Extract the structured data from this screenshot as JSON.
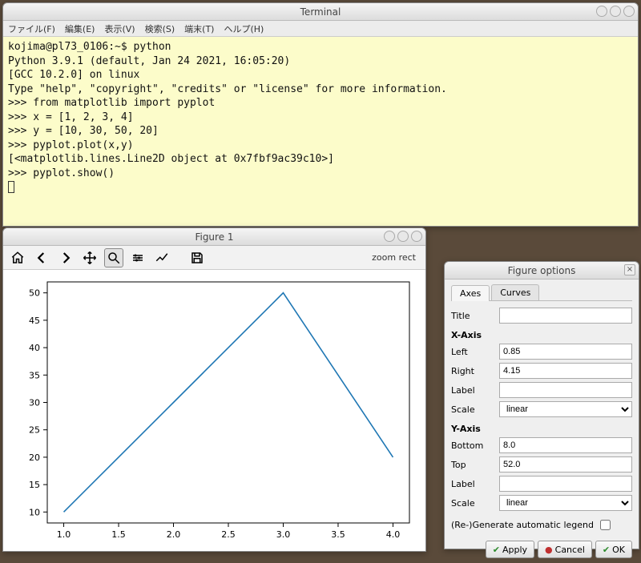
{
  "terminal": {
    "title": "Terminal",
    "menus": [
      "ファイル(F)",
      "編集(E)",
      "表示(V)",
      "検索(S)",
      "端末(T)",
      "ヘルプ(H)"
    ],
    "lines": [
      "kojima@pl73_0106:~$ python",
      "Python 3.9.1 (default, Jan 24 2021, 16:05:20)",
      "[GCC 10.2.0] on linux",
      "Type \"help\", \"copyright\", \"credits\" or \"license\" for more information.",
      ">>> from matplotlib import pyplot",
      ">>> x = [1, 2, 3, 4]",
      ">>> y = [10, 30, 50, 20]",
      ">>> pyplot.plot(x,y)",
      "[<matplotlib.lines.Line2D object at 0x7fbf9ac39c10>]",
      ">>> pyplot.show()"
    ]
  },
  "figure": {
    "title": "Figure 1",
    "toolbar_hint": "zoom rect",
    "toolbar_buttons": [
      "home",
      "back",
      "forward",
      "pan",
      "zoom",
      "subplots",
      "options",
      "save"
    ]
  },
  "options": {
    "title": "Figure options",
    "tabs": {
      "axes": "Axes",
      "curves": "Curves"
    },
    "labels": {
      "title": "Title",
      "xaxis": "X-Axis",
      "left": "Left",
      "right": "Right",
      "label": "Label",
      "scale": "Scale",
      "yaxis": "Y-Axis",
      "bottom": "Bottom",
      "top": "Top",
      "legend": "(Re-)Generate automatic legend",
      "apply": "Apply",
      "cancel": "Cancel",
      "ok": "OK"
    },
    "values": {
      "title": "",
      "x_left": "0.85",
      "x_right": "4.15",
      "x_label": "",
      "x_scale": "linear",
      "y_bottom": "8.0",
      "y_top": "52.0",
      "y_label": "",
      "y_scale": "linear"
    }
  },
  "chart_data": {
    "type": "line",
    "x": [
      1,
      2,
      3,
      4
    ],
    "y": [
      10,
      30,
      50,
      20
    ],
    "series": [
      {
        "name": "",
        "values": [
          10,
          30,
          50,
          20
        ]
      }
    ],
    "x_ticks": [
      1.0,
      1.5,
      2.0,
      2.5,
      3.0,
      3.5,
      4.0
    ],
    "y_ticks": [
      10,
      15,
      20,
      25,
      30,
      35,
      40,
      45,
      50
    ],
    "xlim": [
      0.85,
      4.15
    ],
    "ylim": [
      8.0,
      52.0
    ],
    "title": "",
    "xlabel": "",
    "ylabel": "",
    "line_color": "#1f77b4"
  }
}
